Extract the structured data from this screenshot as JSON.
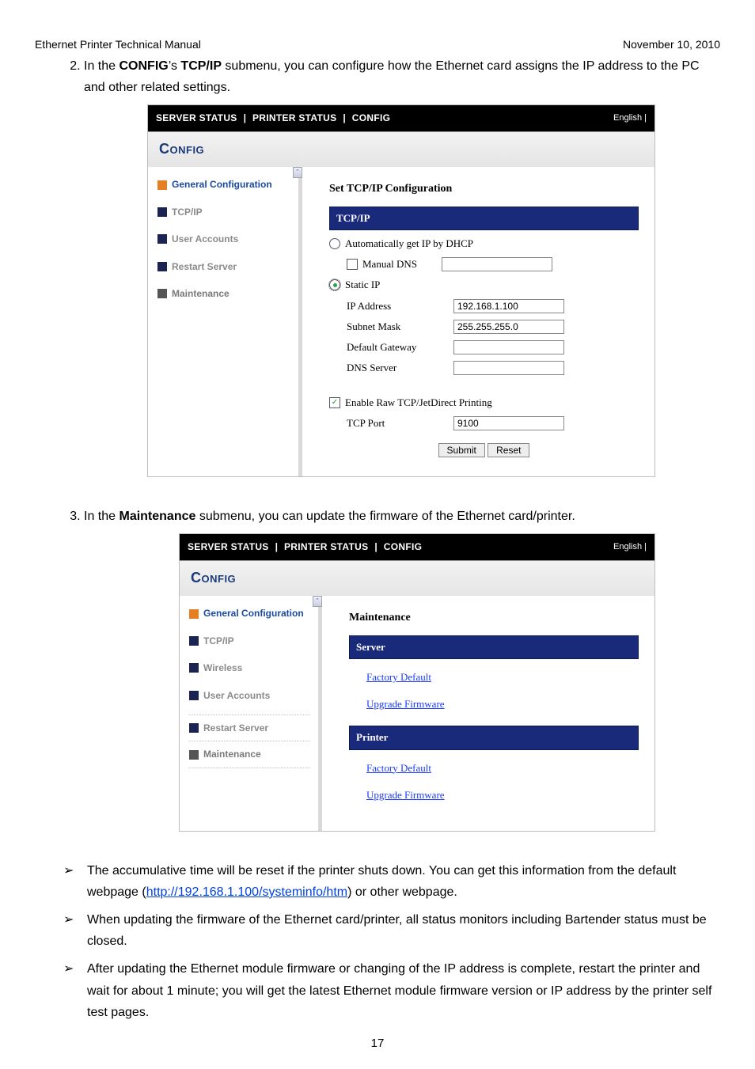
{
  "header": {
    "left": "Ethernet Printer Technical Manual",
    "right": "November 10, 2010"
  },
  "step2": {
    "pre": "In the ",
    "b1": "CONFIG",
    "mid1": "’s ",
    "b2": "TCP/IP",
    "post": " submenu, you can configure how the Ethernet card assigns the IP address to the PC and other related settings."
  },
  "step3": {
    "pre": "In the ",
    "b1": "Maintenance",
    "post": " submenu, you can update the firmware of the Ethernet card/printer."
  },
  "fig1": {
    "nav": {
      "a": "SERVER STATUS",
      "b": "PRINTER STATUS",
      "c": "CONFIG",
      "lang": "English"
    },
    "brand": "Config",
    "side": {
      "gen": "General Configuration",
      "tcp": "TCP/IP",
      "ua": "User Accounts",
      "rs": "Restart Server",
      "mt": "Maintenance"
    },
    "title": "Set TCP/IP Configuration",
    "banner": "TCP/IP",
    "auto": "Automatically get IP by DHCP",
    "mdns": "Manual DNS",
    "static": "Static IP",
    "ip_lbl": "IP Address",
    "ip_val": "192.168.1.100",
    "sm_lbl": "Subnet Mask",
    "sm_val": "255.255.255.0",
    "gw_lbl": "Default Gateway",
    "gw_val": "",
    "dns_lbl": "DNS Server",
    "dns_val": "",
    "raw": "Enable Raw TCP/JetDirect Printing",
    "port_lbl": "TCP Port",
    "port_val": "9100",
    "submit": "Submit",
    "reset": "Reset"
  },
  "fig2": {
    "nav": {
      "a": "SERVER STATUS",
      "b": "PRINTER STATUS",
      "c": "CONFIG",
      "lang": "English"
    },
    "brand": "Config",
    "side": {
      "gen": "General Configuration",
      "tcp": "TCP/IP",
      "wl": "Wireless",
      "ua": "User Accounts",
      "rs": "Restart Server",
      "mt": "Maintenance"
    },
    "title": "Maintenance",
    "server_hdr": "Server",
    "printer_hdr": "Printer",
    "factory": "Factory Default",
    "upgrade": "Upgrade Firmware"
  },
  "bullets": {
    "b1a": "The accumulative time will be reset if the printer shuts down. You can get this information from the default webpage (",
    "b1url": "http://192.168.1.100/systeminfo/htm",
    "b1b": ") or other webpage.",
    "b2": "When updating the firmware of the Ethernet card/printer, all status monitors including Bartender status must be closed.",
    "b3": "After updating the Ethernet module firmware or changing of the IP address is complete, restart the printer and wait for about 1 minute; you will get the latest Ethernet module firmware version or IP address by the printer self test pages."
  },
  "page_num": "17"
}
